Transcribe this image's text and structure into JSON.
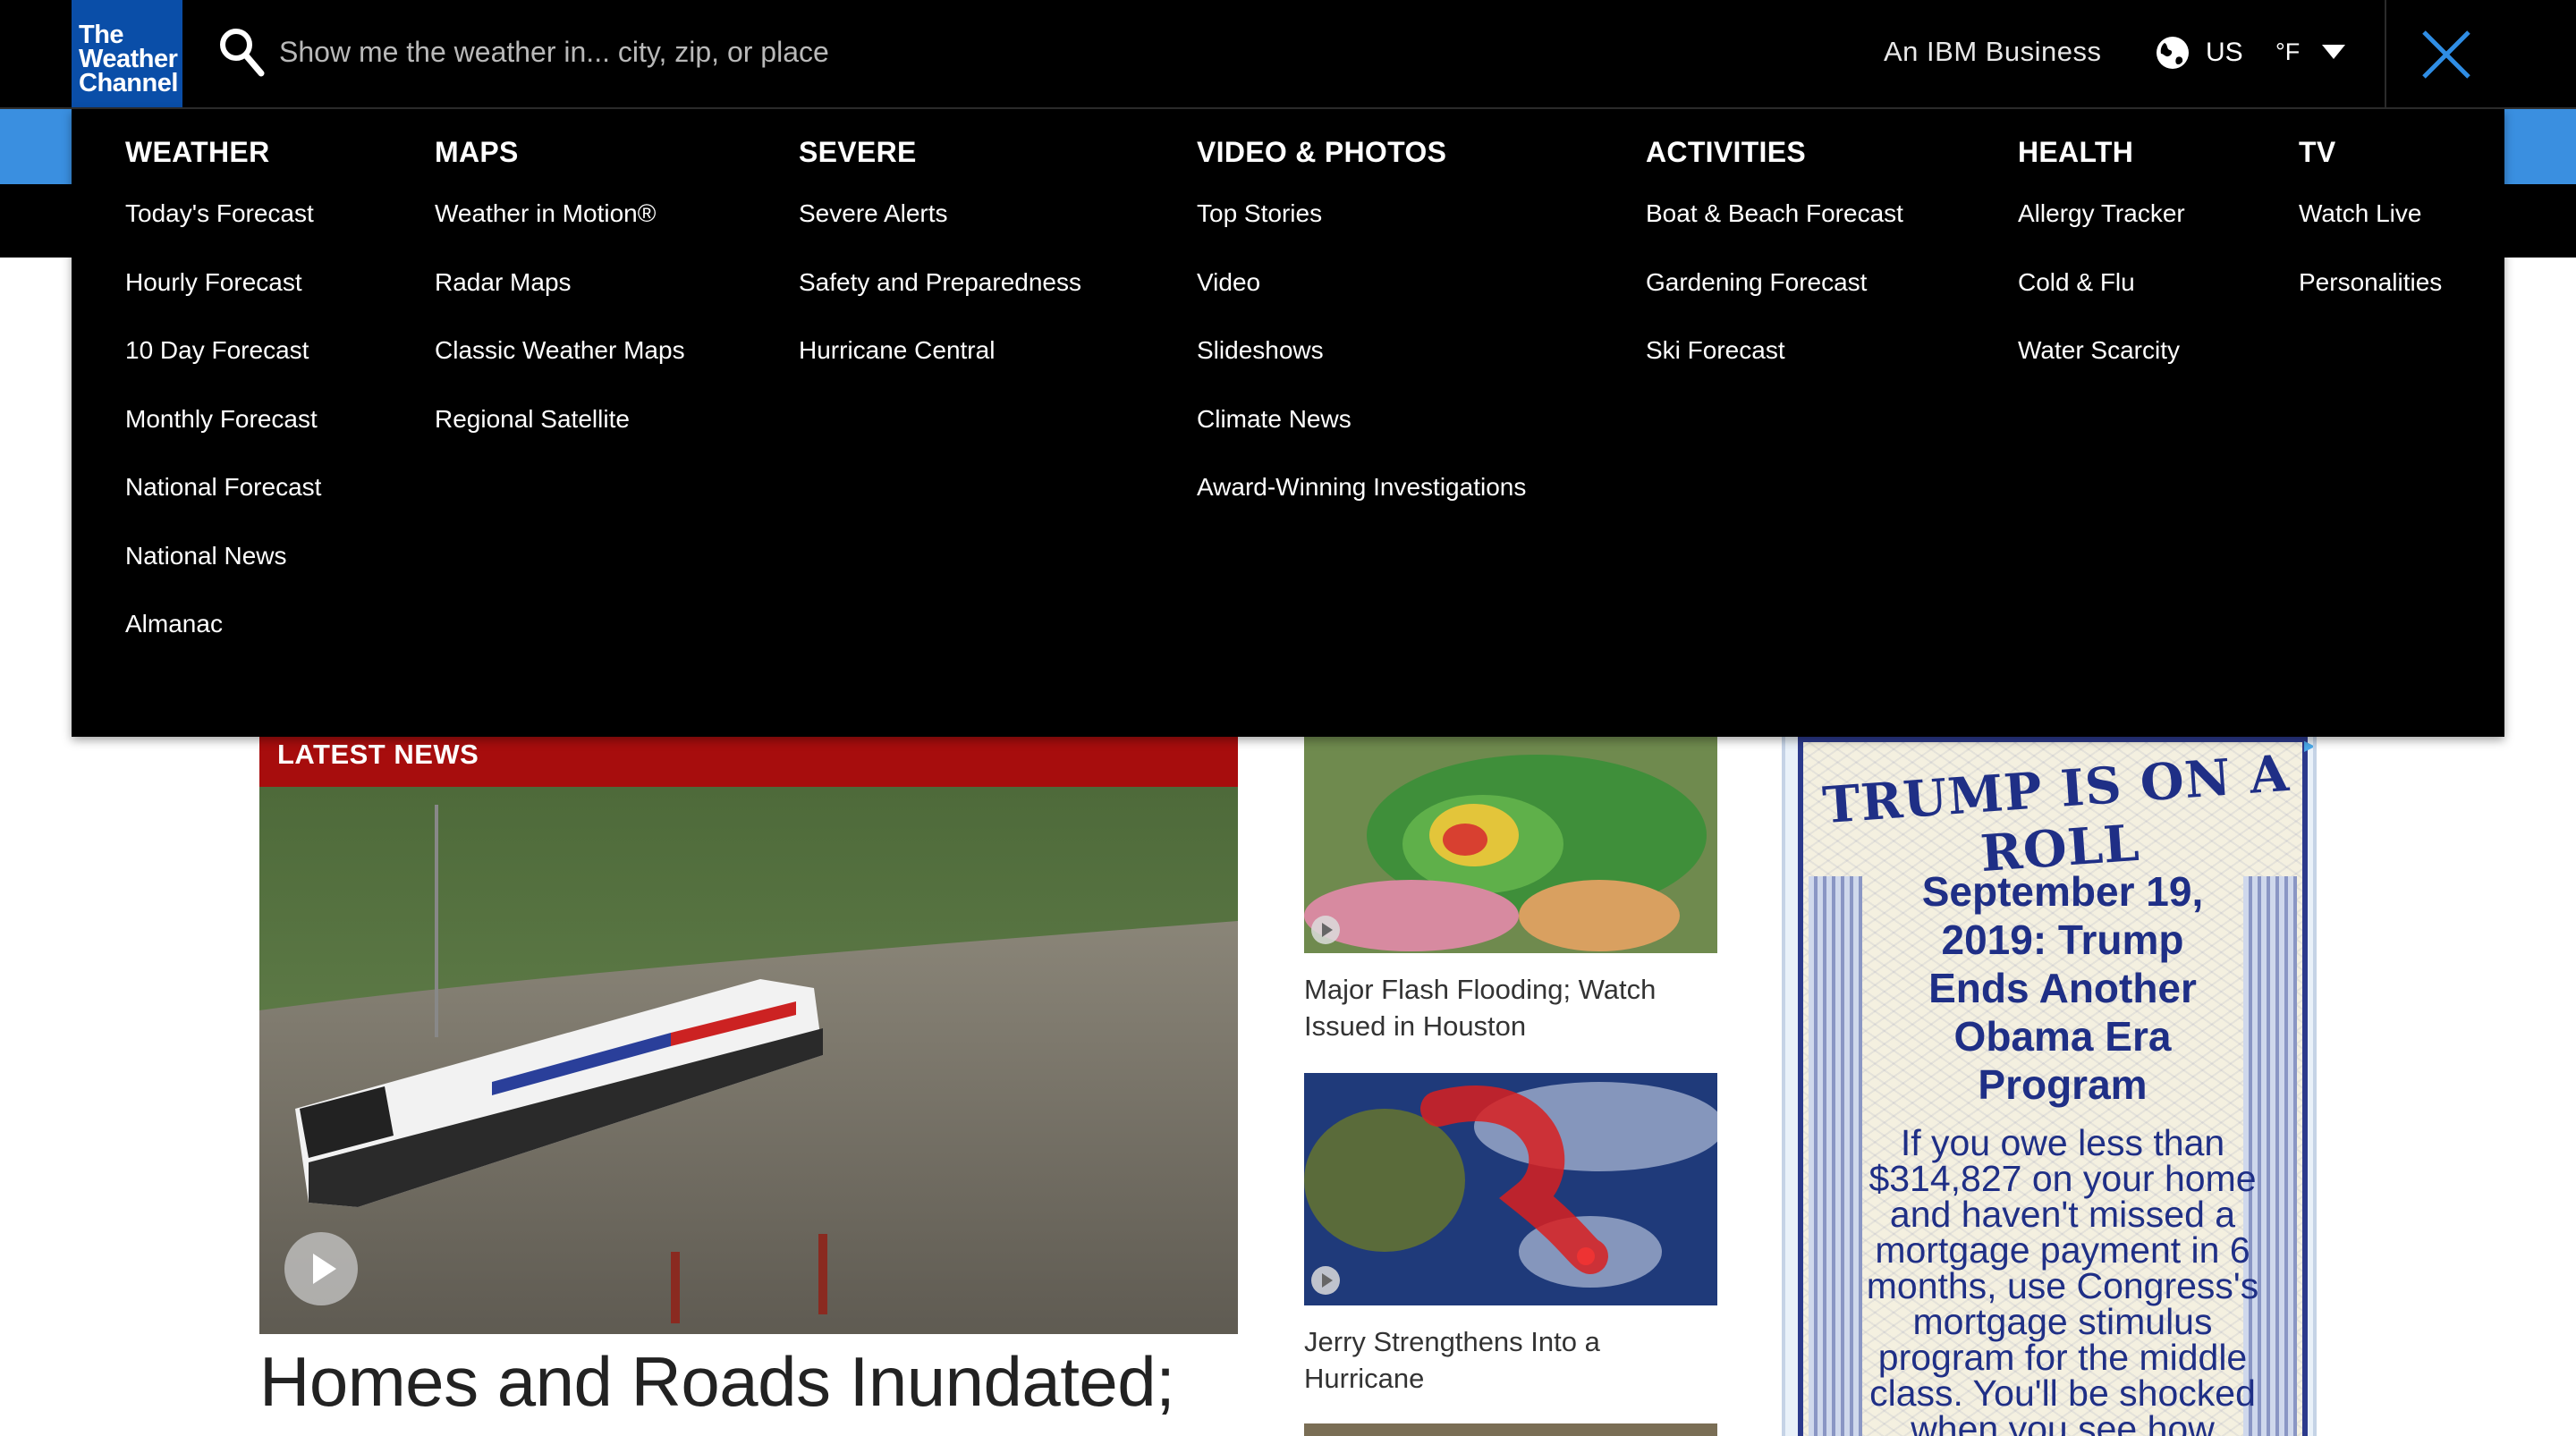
{
  "header": {
    "logo_lines": [
      "The",
      "Weather",
      "Channel"
    ],
    "search_placeholder": "Show me the weather in... city, zip, or place",
    "ibm_label": "An IBM Business",
    "region": "US",
    "unit": "°F"
  },
  "menu": {
    "columns": [
      {
        "title": "WEATHER",
        "items": [
          "Today's Forecast",
          "Hourly Forecast",
          "10 Day Forecast",
          "Monthly Forecast",
          "National Forecast",
          "National News",
          "Almanac"
        ]
      },
      {
        "title": "MAPS",
        "items": [
          "Weather in Motion®",
          "Radar Maps",
          "Classic Weather Maps",
          "Regional Satellite"
        ]
      },
      {
        "title": "SEVERE",
        "items": [
          "Severe Alerts",
          "Safety and Preparedness",
          "Hurricane Central"
        ]
      },
      {
        "title": "VIDEO & PHOTOS",
        "items": [
          "Top Stories",
          "Video",
          "Slideshows",
          "Climate News",
          "Award-Winning Investigations"
        ]
      },
      {
        "title": "ACTIVITIES",
        "items": [
          "Boat & Beach Forecast",
          "Gardening Forecast",
          "Ski Forecast"
        ]
      },
      {
        "title": "HEALTH",
        "items": [
          "Allergy Tracker",
          "Cold & Flu",
          "Water Scarcity"
        ]
      },
      {
        "title": "TV",
        "items": [
          "Watch Live",
          "Personalities"
        ]
      }
    ]
  },
  "main": {
    "latest_label": "LATEST NEWS",
    "headline": "Homes and Roads Inundated;",
    "stories": [
      {
        "title": "Major Flash Flooding; Watch Issued in Houston"
      },
      {
        "title": "Jerry Strengthens Into a Hurricane"
      }
    ]
  },
  "ad": {
    "title": "TRUMP IS ON A ROLL",
    "headline": "September 19, 2019: Trump Ends Another Obama Era Program",
    "body": "If you owe less than $314,827 on your home and haven't missed a mortgage payment in 6 months, use Congress's mortgage stimulus program for the middle class. You'll be shocked when you see how"
  },
  "colors": {
    "brand_blue": "#0a4ea8",
    "accent_blue": "#3a8fe0",
    "close_blue": "#2f8de4",
    "latest_red": "#a70d0d",
    "ad_navy": "#1f2f86"
  }
}
